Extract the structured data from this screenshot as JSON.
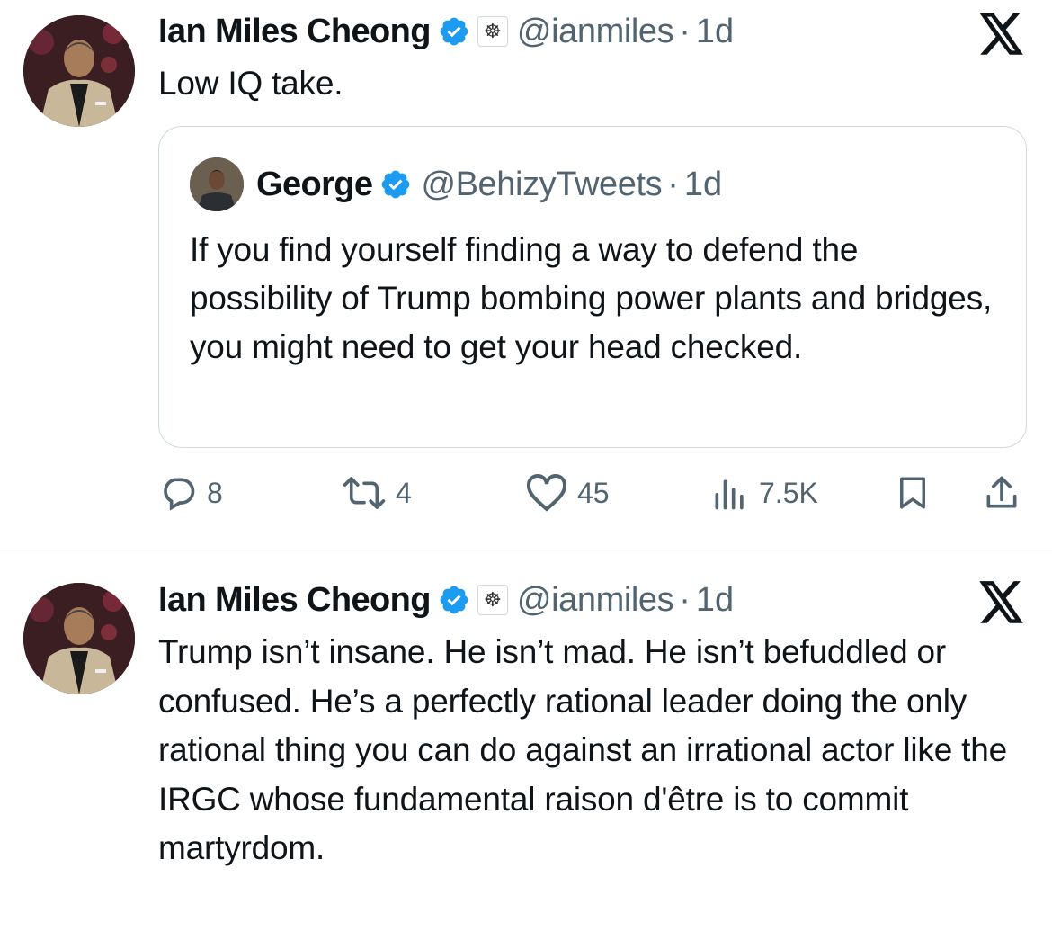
{
  "tweets": [
    {
      "author": {
        "name": "Ian Miles Cheong",
        "handle": "@ianmiles",
        "time": "1d",
        "separator": "·"
      },
      "text": "Low IQ take.",
      "quote": {
        "author": {
          "name": "George",
          "handle": "@BehizyTweets",
          "time": "1d",
          "separator": "·"
        },
        "text": "If you find yourself finding a way to defend the possibility of Trump bombing power plants and bridges, you might need to get your head checked."
      },
      "stats": {
        "replies": "8",
        "reposts": "4",
        "likes": "45",
        "views": "7.5K"
      }
    },
    {
      "author": {
        "name": "Ian Miles Cheong",
        "handle": "@ianmiles",
        "time": "1d",
        "separator": "·"
      },
      "text": "Trump isn’t insane. He isn’t mad. He isn’t befuddled or confused. He’s a perfectly rational leader doing the only rational thing you can do against an irrational actor like the IRGC whose fundamental raison d'être is to commit martyrdom."
    }
  ],
  "colors": {
    "text": "#0f1419",
    "secondary": "#536471",
    "verified": "#1d9bf0",
    "border": "#cfd9de"
  },
  "icons": {
    "verified": "verified-badge-icon",
    "affiliate": "affiliate-badge-icon",
    "logo": "x-logo-icon",
    "reply": "reply-icon",
    "repost": "repost-icon",
    "like": "heart-icon",
    "views": "views-icon",
    "bookmark": "bookmark-icon",
    "share": "share-icon"
  }
}
